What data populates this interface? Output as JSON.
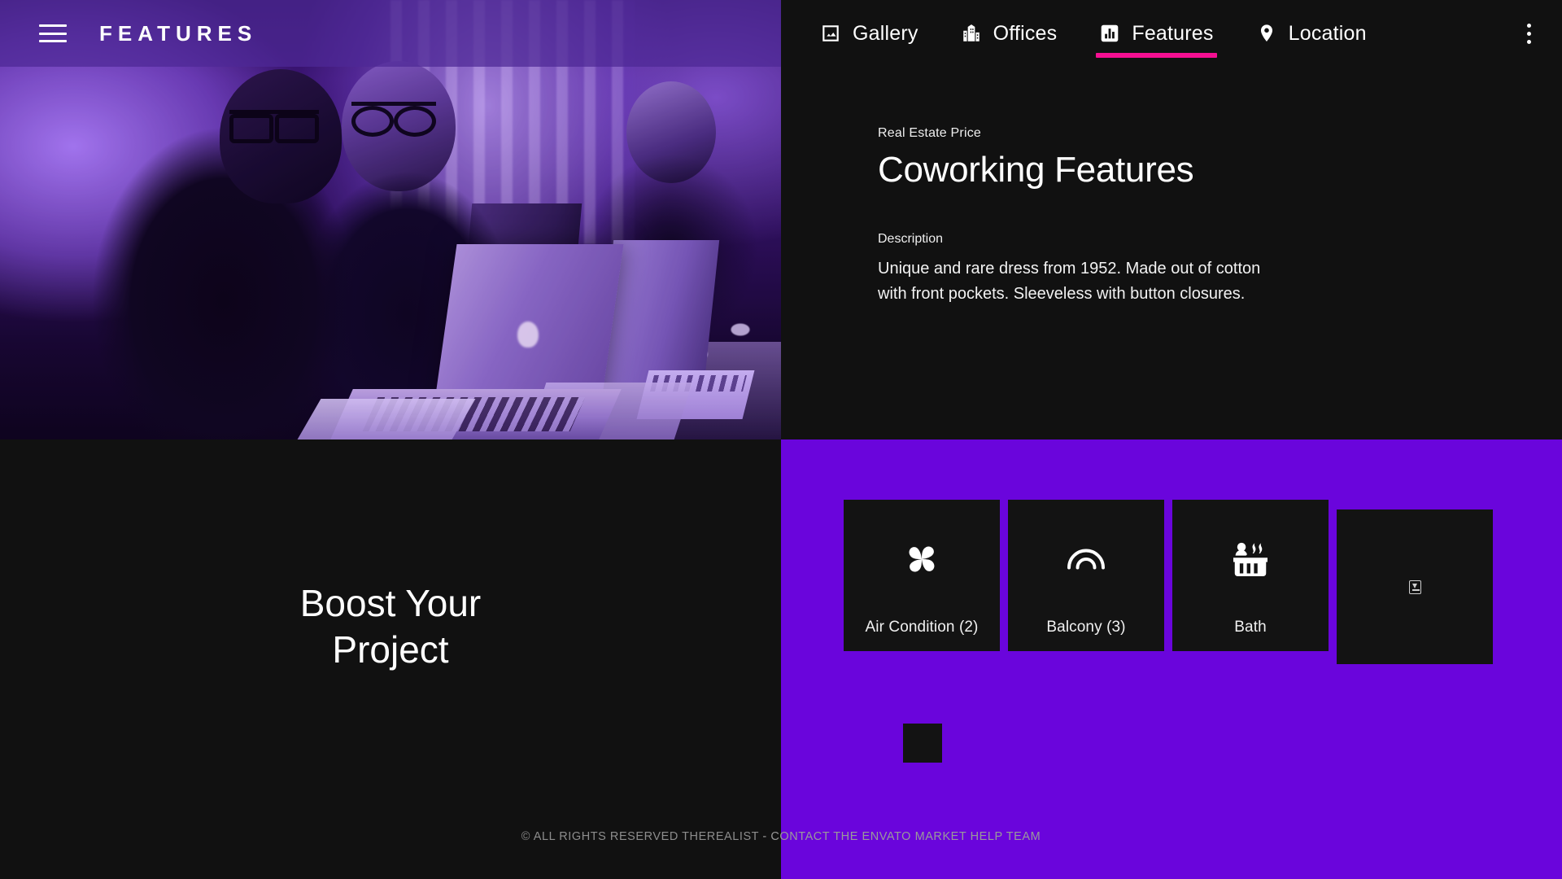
{
  "header": {
    "menu_icon": "hamburger-icon",
    "brand": "FEATURES"
  },
  "nav": {
    "tabs": [
      {
        "label": "Gallery",
        "icon": "image-icon",
        "active": false
      },
      {
        "label": "Offices",
        "icon": "building-icon",
        "active": false
      },
      {
        "label": "Features",
        "icon": "bar-chart-icon",
        "active": true
      },
      {
        "label": "Location",
        "icon": "map-pin-icon",
        "active": false
      }
    ],
    "overflow_icon": "kebab-menu-icon",
    "active_indicator_color": "#F50F92"
  },
  "detail": {
    "eyebrow": "Real Estate Price",
    "title": "Coworking Features",
    "description_label": "Description",
    "description": "Unique and rare dress from 1952. Made out of cotton with front pockets. Sleeveless with button closures."
  },
  "promo": {
    "text": "Boost Your Project"
  },
  "features": {
    "cards": [
      {
        "label": "Air Condition (2)",
        "icon": "fan-icon"
      },
      {
        "label": "Balcony (3)",
        "icon": "arch-icon"
      },
      {
        "label": "Bath",
        "icon": "hot-tub-icon"
      },
      {
        "label": "",
        "icon": "broken-image-icon"
      }
    ]
  },
  "footer": {
    "copyright": "© ALL RIGHTS RESERVED THEREALIST ",
    "contact": " - CONTACT THE ENVATO MARKET HELP TEAM"
  },
  "colors": {
    "accent_pink": "#F50F92",
    "panel_purple": "#6A05DC",
    "panel_dark": "#111111",
    "card_dark": "#131313"
  }
}
